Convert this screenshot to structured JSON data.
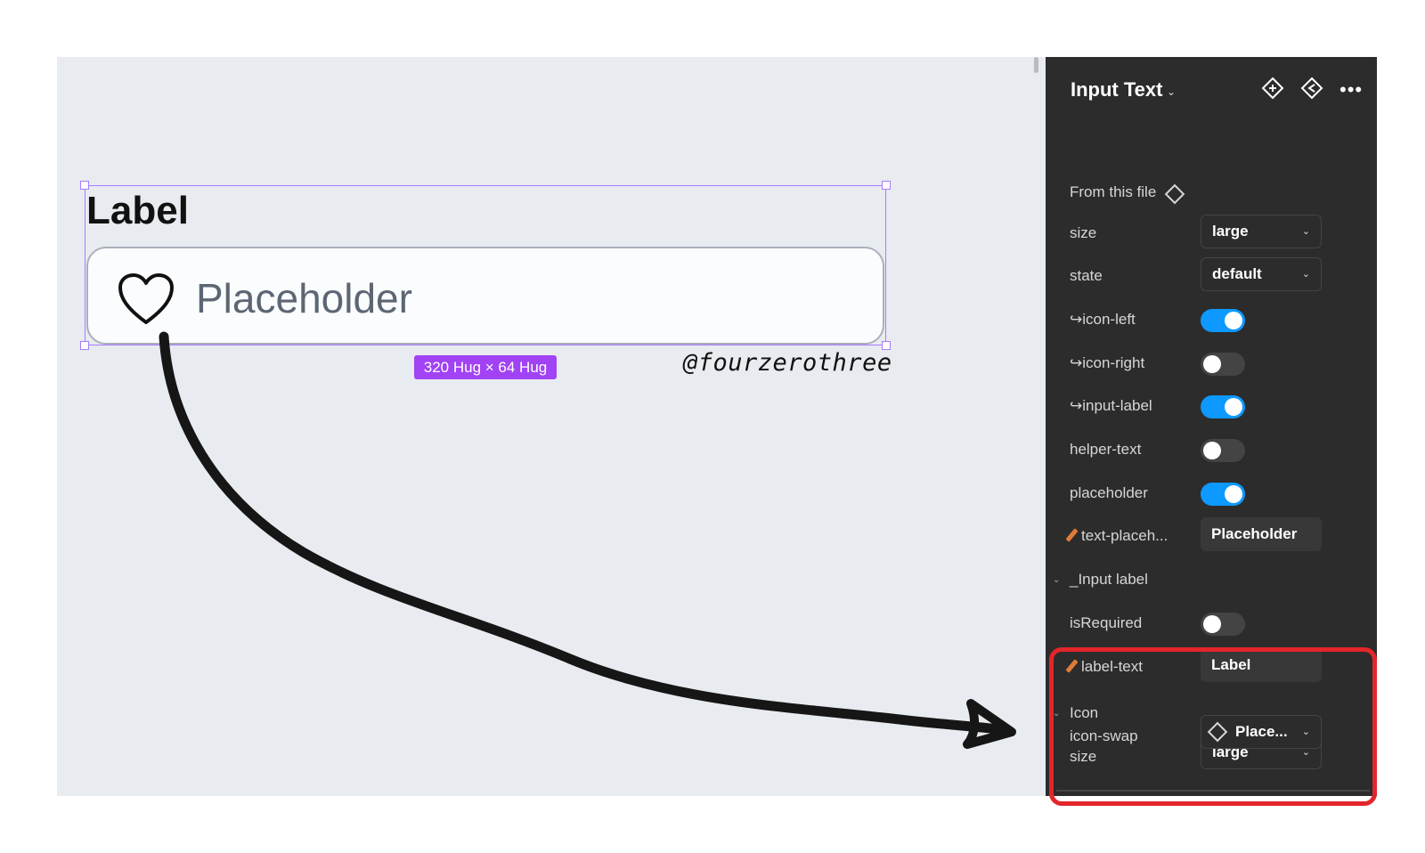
{
  "canvas": {
    "component_label": "Label",
    "placeholder": "Placeholder",
    "size_badge": "320 Hug × 64 Hug",
    "watermark": "@fourzerothree"
  },
  "panel": {
    "title": "Input Text",
    "source_text": "From this file",
    "props": {
      "size_label": "size",
      "size_value": "large",
      "state_label": "state",
      "state_value": "default",
      "icon_left_label": "↪icon-left",
      "icon_left_on": true,
      "icon_right_label": "↪icon-right",
      "icon_right_on": false,
      "input_label_label": "↪input-label",
      "input_label_on": true,
      "helper_text_label": "helper-text",
      "helper_text_on": false,
      "placeholder_label": "placeholder",
      "placeholder_on": true,
      "text_placeholder_label": "text-placeh...",
      "text_placeholder_value": "Placeholder"
    },
    "input_label_section": {
      "title": "_Input label",
      "is_required_label": "isRequired",
      "is_required_on": false,
      "label_text_label": "label-text",
      "label_text_value": "Label"
    },
    "icon_section": {
      "title": "Icon",
      "size_label": "size",
      "size_value": "large",
      "icon_swap_label": "icon-swap",
      "icon_swap_value": "Place..."
    }
  },
  "colors": {
    "canvas_bg": "#e8ebef",
    "panel_bg": "#2c2c2c",
    "selection": "#a97cff",
    "toggle_on": "#0d99ff",
    "highlight": "#e3262a"
  }
}
